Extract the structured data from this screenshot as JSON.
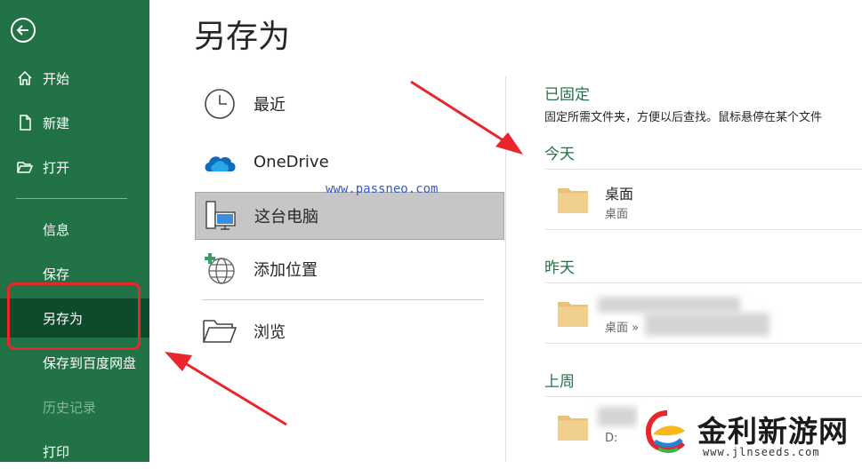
{
  "sidebar": {
    "back_icon": "back-arrow-icon",
    "items": [
      {
        "label": "开始",
        "icon": "home-icon"
      },
      {
        "label": "新建",
        "icon": "new-file-icon"
      },
      {
        "label": "打开",
        "icon": "open-folder-icon"
      },
      {
        "label": "信息"
      },
      {
        "label": "保存"
      },
      {
        "label": "另存为"
      },
      {
        "label": "保存到百度网盘"
      },
      {
        "label": "历史记录"
      },
      {
        "label": "打印"
      }
    ],
    "bg_color": "#217346",
    "active_color": "#0e4b2a"
  },
  "page_title": "另存为",
  "locations": [
    {
      "label": "最近",
      "icon": "clock-icon"
    },
    {
      "label": "OneDrive",
      "icon": "cloud-icon"
    },
    {
      "label": "这台电脑",
      "icon": "computer-icon"
    },
    {
      "label": "添加位置",
      "icon": "add-globe-icon"
    },
    {
      "label": "浏览",
      "icon": "folder-open-icon"
    }
  ],
  "watermark": "www.passneo.com",
  "pinned": {
    "heading": "已固定",
    "description": "固定所需文件夹，方便以后查找。鼠标悬停在某个文件"
  },
  "groups": [
    {
      "heading": "今天",
      "folders": [
        {
          "name": "桌面",
          "path": "桌面"
        }
      ]
    },
    {
      "heading": "昨天",
      "folders": [
        {
          "name": "",
          "path": "桌面 »"
        }
      ]
    },
    {
      "heading": "上周",
      "folders": [
        {
          "name": "",
          "path": "D:"
        }
      ]
    }
  ],
  "logo": {
    "text": "金利新游网",
    "url": "www.jlnseeds.com"
  },
  "colors": {
    "accent": "#217346",
    "highlight_red": "#e8262b"
  }
}
